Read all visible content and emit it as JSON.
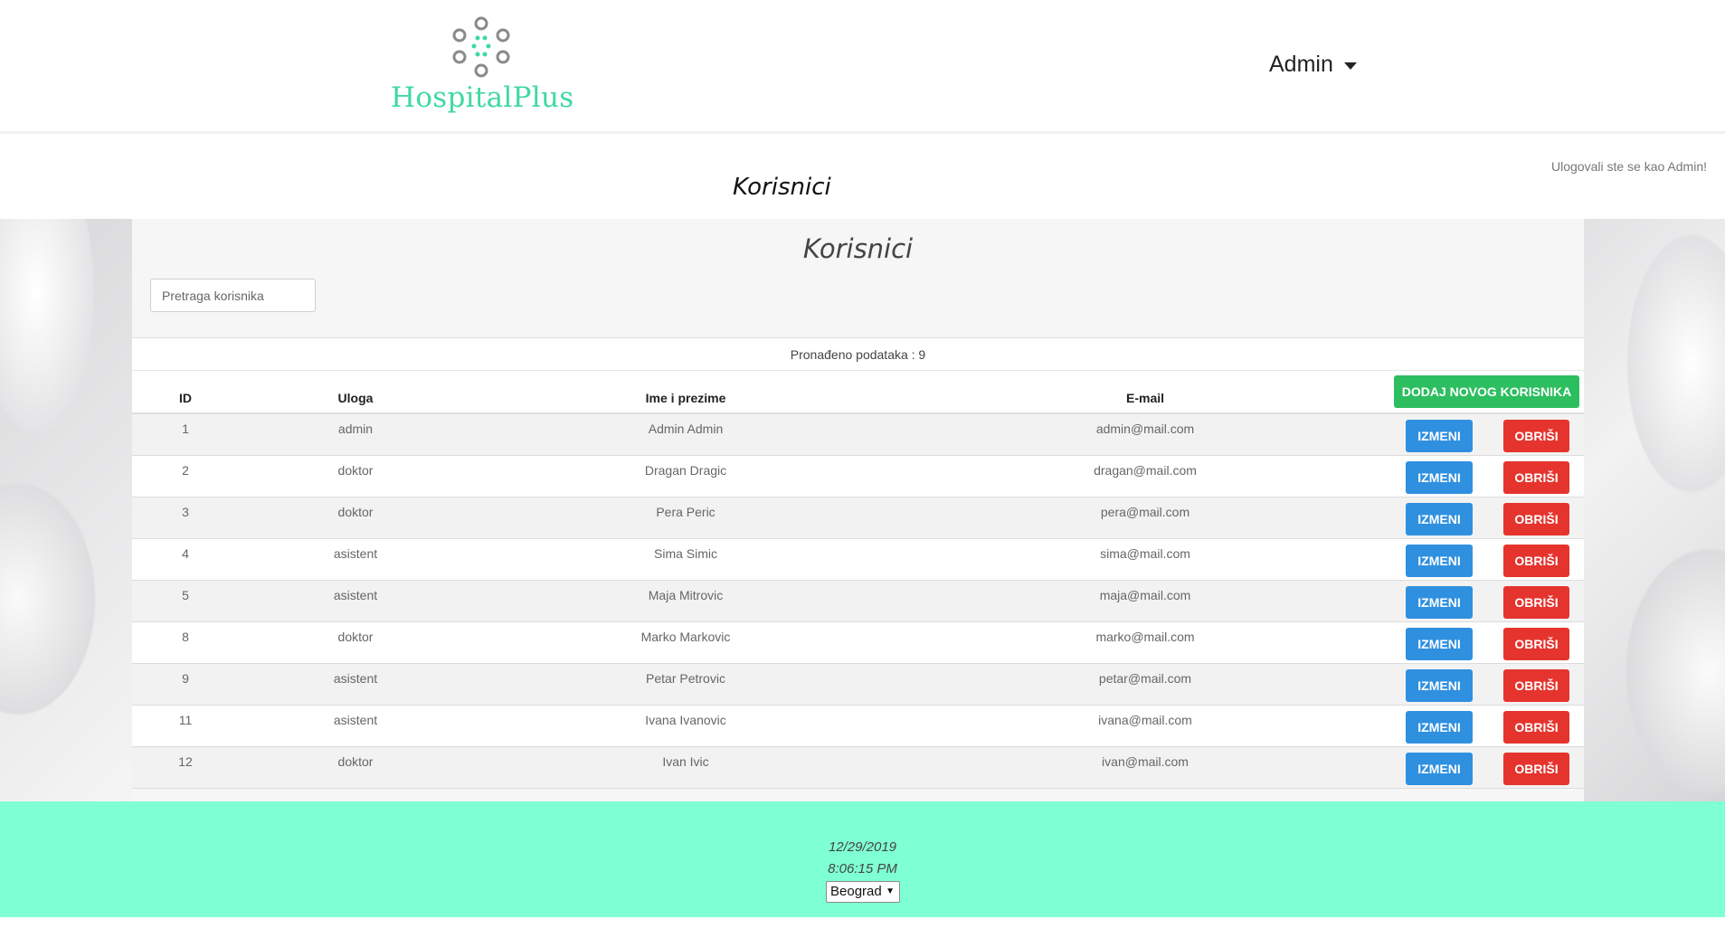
{
  "header": {
    "brand": "HospitalPlus",
    "user_menu": "Admin",
    "colors": {
      "brand": "#3fd9a0",
      "logo_ring": "#8a8a8a"
    }
  },
  "status": {
    "logged_in_text": "Ulogovali ste se kao Admin!"
  },
  "page": {
    "title": "Korisnici"
  },
  "panel": {
    "title": "Korisnici",
    "search_placeholder": "Pretraga korisnika",
    "found_text": "Pronađeno podataka : 9",
    "add_button": "DODAJ NOVOG KORISNIKA"
  },
  "table": {
    "columns": {
      "id": "ID",
      "role": "Uloga",
      "name": "Ime i prezime",
      "email": "E-mail"
    },
    "edit_label": "IZMENI",
    "delete_label": "OBRIŠI",
    "rows": [
      {
        "id": "1",
        "role": "admin",
        "name": "Admin Admin",
        "email": "admin@mail.com"
      },
      {
        "id": "2",
        "role": "doktor",
        "name": "Dragan Dragic",
        "email": "dragan@mail.com"
      },
      {
        "id": "3",
        "role": "doktor",
        "name": "Pera Peric",
        "email": "pera@mail.com"
      },
      {
        "id": "4",
        "role": "asistent",
        "name": "Sima Simic",
        "email": "sima@mail.com"
      },
      {
        "id": "5",
        "role": "asistent",
        "name": "Maja Mitrovic",
        "email": "maja@mail.com"
      },
      {
        "id": "8",
        "role": "doktor",
        "name": "Marko Markovic",
        "email": "marko@mail.com"
      },
      {
        "id": "9",
        "role": "asistent",
        "name": "Petar Petrovic",
        "email": "petar@mail.com"
      },
      {
        "id": "11",
        "role": "asistent",
        "name": "Ivana Ivanovic",
        "email": "ivana@mail.com"
      },
      {
        "id": "12",
        "role": "doktor",
        "name": "Ivan Ivic",
        "email": "ivan@mail.com"
      }
    ]
  },
  "footer": {
    "date": "12/29/2019",
    "time": "8:06:15 PM",
    "city_selected": "Beograd",
    "colors": {
      "background": "#7fffd4"
    }
  },
  "button_colors": {
    "add": "#2dbe60",
    "edit": "#2f90e0",
    "delete": "#e5342e"
  }
}
